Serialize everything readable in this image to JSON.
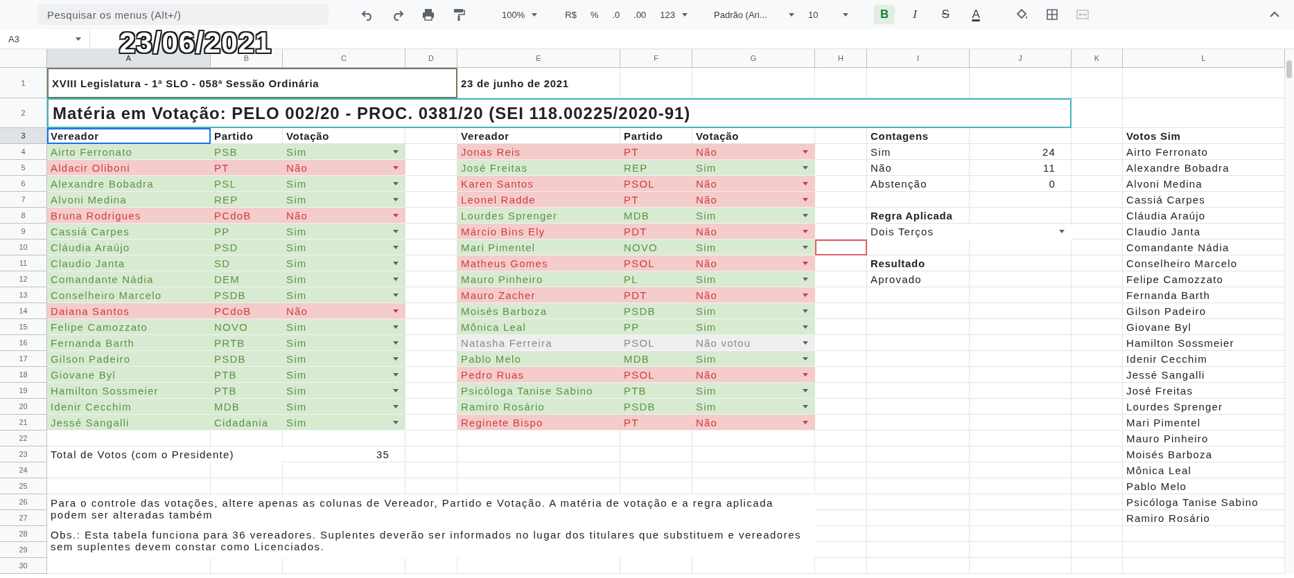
{
  "toolbar": {
    "search": {
      "placeholder": "Pesquisar os menus (Alt+/)"
    },
    "zoom": "100%",
    "format_buttons": [
      "R$",
      "%",
      ".0",
      ".00"
    ],
    "number_format": "123",
    "font": "Padrão (Ari...",
    "font_size": "10",
    "text_styles": [
      {
        "label": "B",
        "kind": "bold",
        "selected": true
      },
      {
        "label": "I",
        "kind": "italic",
        "selected": false
      },
      {
        "label": "S",
        "kind": "strike",
        "selected": false
      },
      {
        "label": "A",
        "kind": "color",
        "selected": false
      }
    ]
  },
  "name_box": "A3",
  "overlay_date": "23/06/2021",
  "sheet": {
    "columns": [
      {
        "label": "A",
        "selected": true
      },
      {
        "label": "B",
        "selected": false
      },
      {
        "label": "C",
        "selected": false
      },
      {
        "label": "D",
        "selected": false
      },
      {
        "label": "E",
        "selected": false
      },
      {
        "label": "F",
        "selected": false
      },
      {
        "label": "G",
        "selected": false
      },
      {
        "label": "H",
        "selected": false
      },
      {
        "label": "I",
        "selected": false
      },
      {
        "label": "J",
        "selected": false
      },
      {
        "label": "K",
        "selected": false
      },
      {
        "label": "L",
        "selected": false
      }
    ],
    "rows": [
      {
        "label": "1",
        "selected": false
      },
      {
        "label": "2",
        "selected": false
      },
      {
        "label": "3",
        "selected": true
      },
      {
        "label": "4",
        "selected": false
      },
      {
        "label": "5",
        "selected": false
      },
      {
        "label": "6",
        "selected": false
      },
      {
        "label": "7",
        "selected": false
      },
      {
        "label": "8",
        "selected": false
      },
      {
        "label": "9",
        "selected": false
      },
      {
        "label": "10",
        "selected": false
      },
      {
        "label": "11",
        "selected": false
      },
      {
        "label": "12",
        "selected": false
      },
      {
        "label": "13",
        "selected": false
      },
      {
        "label": "14",
        "selected": false
      },
      {
        "label": "15",
        "selected": false
      },
      {
        "label": "16",
        "selected": false
      },
      {
        "label": "17",
        "selected": false
      },
      {
        "label": "18",
        "selected": false
      },
      {
        "label": "19",
        "selected": false
      },
      {
        "label": "20",
        "selected": false
      },
      {
        "label": "21",
        "selected": false
      },
      {
        "label": "22",
        "selected": false
      },
      {
        "label": "23",
        "selected": false
      },
      {
        "label": "24",
        "selected": false
      },
      {
        "label": "25",
        "selected": false
      },
      {
        "label": "26",
        "selected": false
      },
      {
        "label": "27",
        "selected": false
      },
      {
        "label": "28",
        "selected": false
      },
      {
        "label": "29",
        "selected": false
      },
      {
        "label": "30",
        "selected": false
      }
    ]
  },
  "session_title": "XVIII Legislatura - 1ª SLO - 058ª Sessão Ordinária",
  "session_date": "23 de junho de 2021",
  "subject": "Matéria em Votação: PELO 002/20 - PROC. 0381/20 (SEI 118.00225/2020-91)",
  "vote_tables": [
    {
      "headers": [
        "Vereador",
        "Partido",
        "Votação"
      ],
      "rows": [
        {
          "name": "Airto Ferronato",
          "party": "PSB",
          "vote": "Sim",
          "kind": "sim"
        },
        {
          "name": "Aldacir Oliboni",
          "party": "PT",
          "vote": "Não",
          "kind": "nao"
        },
        {
          "name": "Alexandre Bobadra",
          "party": "PSL",
          "vote": "Sim",
          "kind": "sim"
        },
        {
          "name": "Alvoni Medina",
          "party": "REP",
          "vote": "Sim",
          "kind": "sim"
        },
        {
          "name": "Bruna Rodrigues",
          "party": "PCdoB",
          "vote": "Não",
          "kind": "nao"
        },
        {
          "name": "Cassiá Carpes",
          "party": "PP",
          "vote": "Sim",
          "kind": "sim"
        },
        {
          "name": "Cláudia Araújo",
          "party": "PSD",
          "vote": "Sim",
          "kind": "sim"
        },
        {
          "name": "Claudio Janta",
          "party": "SD",
          "vote": "Sim",
          "kind": "sim"
        },
        {
          "name": "Comandante Nádia",
          "party": "DEM",
          "vote": "Sim",
          "kind": "sim"
        },
        {
          "name": "Conselheiro Marcelo",
          "party": "PSDB",
          "vote": "Sim",
          "kind": "sim"
        },
        {
          "name": "Daiana Santos",
          "party": "PCdoB",
          "vote": "Não",
          "kind": "nao"
        },
        {
          "name": "Felipe Camozzato",
          "party": "NOVO",
          "vote": "Sim",
          "kind": "sim"
        },
        {
          "name": "Fernanda Barth",
          "party": "PRTB",
          "vote": "Sim",
          "kind": "sim"
        },
        {
          "name": "Gilson Padeiro",
          "party": "PSDB",
          "vote": "Sim",
          "kind": "sim"
        },
        {
          "name": "Giovane Byl",
          "party": "PTB",
          "vote": "Sim",
          "kind": "sim"
        },
        {
          "name": "Hamilton Sossmeier",
          "party": "PTB",
          "vote": "Sim",
          "kind": "sim"
        },
        {
          "name": "Idenir Cecchim",
          "party": "MDB",
          "vote": "Sim",
          "kind": "sim"
        },
        {
          "name": "Jessé Sangalli",
          "party": "Cidadania",
          "vote": "Sim",
          "kind": "sim"
        }
      ]
    },
    {
      "headers": [
        "Vereador",
        "Partido",
        "Votação"
      ],
      "rows": [
        {
          "name": "Jonas Reis",
          "party": "PT",
          "vote": "Não",
          "kind": "nao",
          "collaborator_cursor_beside": false
        },
        {
          "name": "José Freitas",
          "party": "REP",
          "vote": "Sim",
          "kind": "sim",
          "collaborator_cursor_beside": false
        },
        {
          "name": "Karen Santos",
          "party": "PSOL",
          "vote": "Não",
          "kind": "nao",
          "collaborator_cursor_beside": false
        },
        {
          "name": "Leonel Radde",
          "party": "PT",
          "vote": "Não",
          "kind": "nao",
          "collaborator_cursor_beside": false
        },
        {
          "name": "Lourdes Sprenger",
          "party": "MDB",
          "vote": "Sim",
          "kind": "sim",
          "collaborator_cursor_beside": false
        },
        {
          "name": "Márcio Bins Ely",
          "party": "PDT",
          "vote": "Não",
          "kind": "nao",
          "collaborator_cursor_beside": false
        },
        {
          "name": "Mari Pimentel",
          "party": "NOVO",
          "vote": "Sim",
          "kind": "sim",
          "collaborator_cursor_beside": true
        },
        {
          "name": "Matheus Gomes",
          "party": "PSOL",
          "vote": "Não",
          "kind": "nao",
          "collaborator_cursor_beside": false
        },
        {
          "name": "Mauro Pinheiro",
          "party": "PL",
          "vote": "Sim",
          "kind": "sim",
          "collaborator_cursor_beside": false
        },
        {
          "name": "Mauro Zacher",
          "party": "PDT",
          "vote": "Não",
          "kind": "nao",
          "collaborator_cursor_beside": false
        },
        {
          "name": "Moisés Barboza",
          "party": "PSDB",
          "vote": "Sim",
          "kind": "sim",
          "collaborator_cursor_beside": false
        },
        {
          "name": "Mônica Leal",
          "party": "PP",
          "vote": "Sim",
          "kind": "sim",
          "collaborator_cursor_beside": false
        },
        {
          "name": "Natasha Ferreira",
          "party": "PSOL",
          "vote": "Não votou",
          "kind": "nao_votou",
          "collaborator_cursor_beside": false
        },
        {
          "name": "Pablo Melo",
          "party": "MDB",
          "vote": "Sim",
          "kind": "sim",
          "collaborator_cursor_beside": false
        },
        {
          "name": "Pedro Ruas",
          "party": "PSOL",
          "vote": "Não",
          "kind": "nao",
          "collaborator_cursor_beside": false
        },
        {
          "name": "Psicóloga Tanise Sabino",
          "party": "PTB",
          "vote": "Sim",
          "kind": "sim",
          "collaborator_cursor_beside": false
        },
        {
          "name": "Ramiro Rosário",
          "party": "PSDB",
          "vote": "Sim",
          "kind": "sim",
          "collaborator_cursor_beside": false
        },
        {
          "name": "Reginete Bispo",
          "party": "PT",
          "vote": "Não",
          "kind": "nao",
          "collaborator_cursor_beside": false
        }
      ]
    }
  ],
  "counts": {
    "title": "Contagens",
    "items": [
      {
        "label": "Sim",
        "value": "24"
      },
      {
        "label": "Não",
        "value": "11"
      },
      {
        "label": "Abstenção",
        "value": "0"
      }
    ]
  },
  "rule": {
    "title": "Regra Aplicada",
    "value": "Dois Terços"
  },
  "result": {
    "title": "Resultado",
    "value": "Aprovado"
  },
  "yes_votes": {
    "title": "Votos Sim",
    "names": [
      "Airto Ferronato",
      "Alexandre Bobadra",
      "Alvoni Medina",
      "Cassiá Carpes",
      "Cláudia Araújo",
      "Claudio Janta",
      "Comandante Nádia",
      "Conselheiro Marcelo",
      "Felipe Camozzato",
      "Fernanda Barth",
      "Gilson Padeiro",
      "Giovane Byl",
      "Hamilton Sossmeier",
      "Idenir Cecchim",
      "Jessé Sangalli",
      "José Freitas",
      "Lourdes Sprenger",
      "Mari Pimentel",
      "Mauro Pinheiro",
      "Moisés Barboza",
      "Mônica Leal",
      "Pablo Melo",
      "Psicóloga Tanise Sabino",
      "Ramiro Rosário"
    ]
  },
  "total": {
    "label": "Total de Votos (com o Presidente)",
    "value": "35"
  },
  "notes": [
    "Para o controle das votações, altere apenas as colunas de Vereador, Partido e Votação. A matéria de votação e a regra aplicada podem ser alteradas também",
    "Obs.: Esta tabela funciona para 36 vereadores. Suplentes deverão ser informados no lugar dos titulares que substituem e vereadores sem suplentes devem constar como Licenciados."
  ]
}
